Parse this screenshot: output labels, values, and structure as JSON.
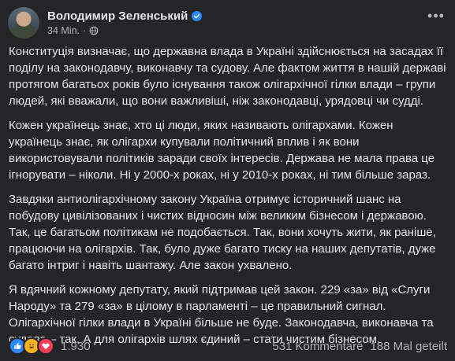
{
  "author": {
    "name": "Володимир Зеленський",
    "time": "34 Min."
  },
  "more_label": "•••",
  "icons": {
    "verified": "verified-badge-icon",
    "audience": "globe-icon",
    "reactions": [
      "like-icon",
      "haha-icon",
      "love-icon"
    ]
  },
  "colors": {
    "background": "#242526",
    "text": "#e4e6eb",
    "secondary": "#b0b3b8",
    "accent": "#2d88ff",
    "love": "#f33e58",
    "haha": "#f7b125"
  },
  "paragraphs": [
    "Конституція визначає, що державна влада в Україні здійснюється на засадах її поділу на законодавчу, виконавчу та судову. Але фактом життя в нашій державі протягом багатьох років було існування також олігархічної гілки влади – групи людей, які вважали, що вони важливіші, ніж законодавці, урядовці чи судді.",
    "Кожен українець знає, хто ці люди, яких називають олігархами. Кожен українець знає, як олігархи купували політичний вплив і як вони використовували політиків заради своїх інтересів. Держава не мала права це ігнорувати – ніколи. Ні у 2000-х роках, ні у 2010-х роках, ні тим більше зараз.",
    "Завдяки антиолігархічному закону Україна отримує історичний шанс на побудову цивілізованих і чистих відносин між великим бізнесом і державою. Так, це багатьом політикам не подобається. Так, вони хочуть жити, як раніше, працюючи на олігархів. Так, було дуже багато тиску на наших депутатів, дуже багато інтриг і навіть шантажу. Але закон ухвалено.",
    "Я вдячний кожному депутату, який підтримав цей закон. 229 «за» від «Слуги Народу» та 279 «за» в цілому в парламенті – це правильний сигнал. Олігархічної гілки влади в Україні більше не буде. Законодавча, виконавча та судова – так. А для олігархів шлях єдиний – стати чистим бізнесом."
  ],
  "footer": {
    "reaction_count": "1.930",
    "comments": "531 Kommentare",
    "shares": "188 Mal geteilt"
  }
}
